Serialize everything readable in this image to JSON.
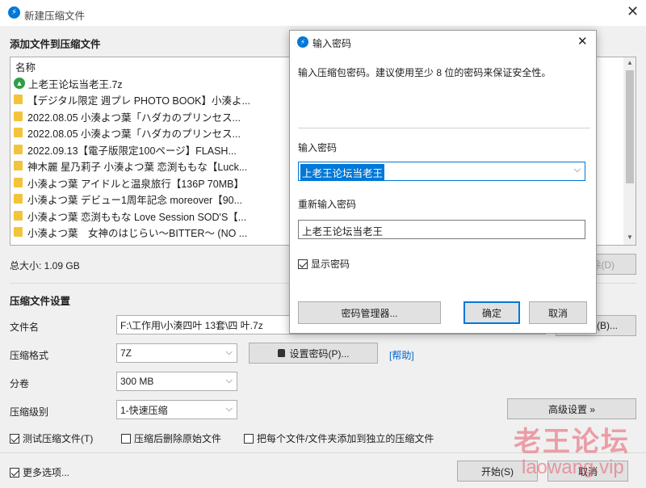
{
  "main_window": {
    "title": "新建压缩文件",
    "section_add": "添加文件到压缩文件",
    "list_header": "名称",
    "files": [
      {
        "icon": "archive-icon",
        "name": "上老王论坛当老王.7z"
      },
      {
        "icon": "folder-icon",
        "name": "【デジタル限定 週プレ PHOTO BOOK】小湊よ..."
      },
      {
        "icon": "folder-icon",
        "name": "2022.08.05 小湊よつ葉「ハダカのプリンセス..."
      },
      {
        "icon": "folder-icon",
        "name": "2022.08.05 小湊よつ葉「ハダカのプリンセス..."
      },
      {
        "icon": "folder-icon",
        "name": "2022.09.13【電子版限定100ページ】FLASH..."
      },
      {
        "icon": "folder-icon",
        "name": "神木麗 星乃莉子 小湊よつ葉 恋渕ももな【Luck..."
      },
      {
        "icon": "folder-icon",
        "name": "小湊よつ葉 アイドルと温泉旅行【136P 70MB】"
      },
      {
        "icon": "folder-icon",
        "name": "小湊よつ葉 デビュー1周年記念 moreover【90..."
      },
      {
        "icon": "folder-icon",
        "name": "小湊よつ葉 恋渕ももな Love Session SOD'S【..."
      },
      {
        "icon": "folder-icon",
        "name": "小湊よつ葉　女神のはじらい～BITTER～ (NO ..."
      }
    ],
    "total_size": "总大小: 1.09 GB",
    "delete_btn_partial": "除(D)",
    "section_settings": "压缩文件设置",
    "filename_label": "文件名",
    "filename_value": "F:\\工作用\\小湊四叶 13套\\四 叶.7z",
    "browse_btn_partial": "(B)...",
    "format_label": "压缩格式",
    "format_value": "7Z",
    "set_password_btn": "设置密码(P)...",
    "help_link": "[帮助]",
    "volume_label": "分卷",
    "volume_value": "300 MB",
    "level_label": "压缩级别",
    "level_value": "1-快速压缩",
    "advanced_btn": "高级设置 »",
    "opt_test": "测试压缩文件(T)",
    "opt_delete": "压缩后删除原始文件",
    "opt_separate": "把每个文件/文件夹添加到独立的压缩文件",
    "more_options": "更多选项...",
    "start_btn": "开始(S)",
    "cancel_btn": "取消",
    "watermark_cn": "老王论坛",
    "watermark_url": "laowang.vip"
  },
  "dialog": {
    "title": "输入密码",
    "description": "输入压缩包密码。建议使用至少 8 位的密码来保证安全性。",
    "enter_label": "输入密码",
    "enter_value": "上老王论坛当老王",
    "reenter_label": "重新输入密码",
    "reenter_value": "上老王论坛当老王",
    "show_password": "显示密码",
    "manager_btn": "密码管理器...",
    "ok_btn": "确定",
    "cancel_btn": "取消"
  },
  "colors": {
    "accent": "#0078d7",
    "link": "#0066cc",
    "watermark": "#e85a6a"
  }
}
